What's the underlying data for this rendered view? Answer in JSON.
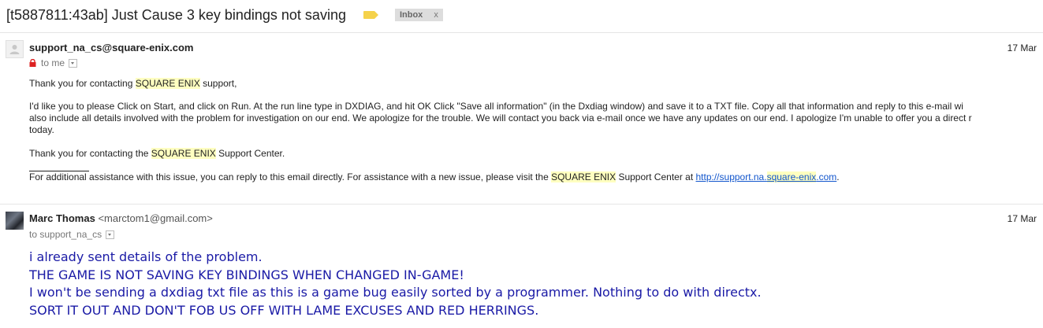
{
  "thread": {
    "subject": "[t5887811:43ab] Just Cause 3 key bindings not saving",
    "label": "Inbox",
    "label_close": "x"
  },
  "messages": [
    {
      "sender": "support_na_cs@square-enix.com",
      "date": "17 Mar",
      "recipient_label": "to me",
      "body": {
        "greeting_pre": "Thank you for contacting ",
        "brand": "SQUARE ENIX",
        "greeting_post": " support,",
        "instructions_1": "I'd like you to please Click on Start, and click on Run. At the run line type in DXDIAG, and hit OK Click \"Save all information\" (in the Dxdiag window) and save it to a TXT file. Copy all that information and reply to this e-mail wi",
        "instructions_2": "also include all details involved with the problem for investigation on our end. We apologize for the trouble. We will contact you back via e-mail once we have any updates on our end.  I apologize I'm unable to offer you a direct r",
        "instructions_3": "today.",
        "thanks_pre": "Thank you for contacting the ",
        "thanks_post": " Support Center.",
        "footer_pre": "For additional assistance with this issue, you can reply to this email directly. For assistance with a new issue, please visit the ",
        "footer_mid": " Support Center at ",
        "link_pre": "http://support.na.",
        "link_hl": "square-enix",
        "link_post": ".com",
        "footer_end": "."
      }
    },
    {
      "sender_name": "Marc Thomas",
      "sender_email": "<marctom1@gmail.com>",
      "date": "17 Mar",
      "recipient_label": "to support_na_cs",
      "lines": [
        "i already sent details of the problem.",
        "THE GAME IS NOT SAVING KEY BINDINGS WHEN CHANGED IN-GAME!",
        "I won't be sending a dxdiag txt file as this is a game bug easily sorted by a programmer. Nothing to do with directx.",
        "SORT IT OUT AND DON'T FOB US OFF WITH LAME EXCUSES AND RED HERRINGS."
      ]
    }
  ],
  "colors": {
    "label_tag": "#f5d24b",
    "highlight": "#ffffc0",
    "link": "#1155cc",
    "reply_text": "#1a1aa6"
  },
  "icons": [
    "label-tag-icon",
    "default-avatar-icon",
    "lock-icon",
    "dropdown-arrow-icon",
    "avatar-photo"
  ]
}
